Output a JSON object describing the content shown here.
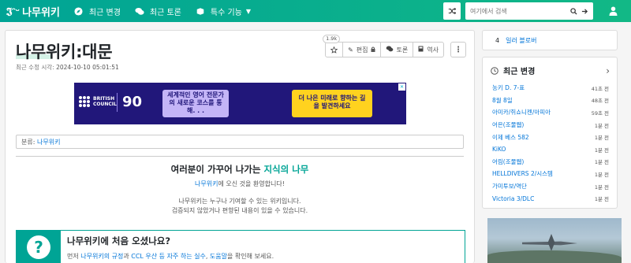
{
  "nav": {
    "logo": "나무위키",
    "items": [
      {
        "label": "최근 변경",
        "icon": "compass-icon"
      },
      {
        "label": "최근 토론",
        "icon": "comments-icon"
      },
      {
        "label": "특수 기능",
        "icon": "cube-icon"
      }
    ],
    "search_placeholder": "여기에서 검색"
  },
  "article": {
    "title": "나무위키:대문",
    "meta_label": "최근 수정 시각:",
    "meta_time": "2024-10-10 05:01:51",
    "toolbar": {
      "star_count": "1.9k",
      "edit": "편집",
      "discuss": "토론",
      "history": "역사"
    },
    "category_label": "분류",
    "category_link": "나무위키",
    "welcome": {
      "title_prefix": "여러분이 가꾸어 나가는 ",
      "title_highlight": "지식의 나무",
      "sub_link": "나무위키",
      "sub_rest": "에 오신 것을 환영합니다!",
      "para1": "나무위키는 누구나 기여할 수 있는 위키입니다.",
      "para2": "검증되지 않았거나 편향된 내용이 있을 수 있습니다."
    },
    "first_time": {
      "title": "나무위키에 처음 오셨나요?",
      "p_prefix": "먼저 ",
      "p_link1": "나무위키의 규정",
      "p_mid1": "과 ",
      "p_link2": "CCL 우산 등 자주 하는 실수",
      "p_mid2": ", ",
      "p_link3": "도움말",
      "p_suffix": "을 확인해 보세요."
    }
  },
  "ad": {
    "brand": "BRITISH COUNCIL",
    "logo_text": "90",
    "box1": "세계적인 영어 전문가의 새로운 코스를 통해. . .",
    "box2": "더 나은 미래로 향하는 길을 발견하세요"
  },
  "sidebar": {
    "top_num": "4",
    "top_link": "일러 블로버",
    "recent_title": "최근 변경",
    "recent": [
      {
        "name": "농키 D. 7-표",
        "time": "41초 전"
      },
      {
        "name": "8월 8일",
        "time": "48초 전"
      },
      {
        "name": "아미카/쥐쇼니젠/아피아",
        "time": "59초 전"
      },
      {
        "name": "어은(조물웹)",
        "time": "1분 전"
      },
      {
        "name": "이제 베스 582",
        "time": "1분 전"
      },
      {
        "name": "KiKO",
        "time": "1분 전"
      },
      {
        "name": "어림(조물웹)",
        "time": "1분 전"
      },
      {
        "name": "HELLDIVERS 2/시스템",
        "time": "1분 전"
      },
      {
        "name": "가미투보/역단",
        "time": "1분 전"
      },
      {
        "name": "Victoria 3/DLC",
        "time": "1분 전"
      }
    ]
  },
  "colors": {
    "brand": "#00a495",
    "link": "#0275d8",
    "ad_bg": "#21177a"
  }
}
